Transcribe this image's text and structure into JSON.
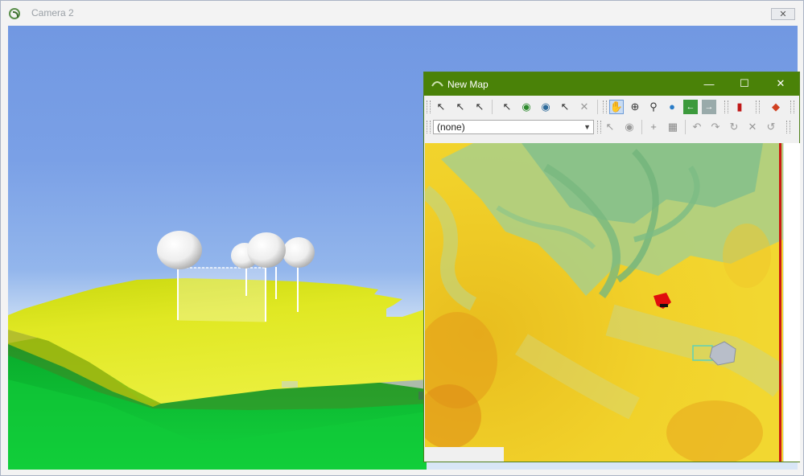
{
  "window": {
    "title": "Camera 2",
    "close_glyph": "✕"
  },
  "map_window": {
    "title": "New Map",
    "minimize": "—",
    "maximize": "☐",
    "close": "✕"
  },
  "toolbar1": {
    "icons": [
      "select-arrow-icon",
      "select-tool-icon",
      "select-attributes-icon",
      "pointer-icon",
      "green-arrow-icon",
      "globe-select-icon",
      "pointer-plus-icon",
      "delete-x-icon",
      "pan-hand-icon",
      "zoom-in-icon",
      "zoom-icon",
      "globe-icon",
      "back-arrow-icon",
      "forward-arrow-icon",
      "red-marker-icon",
      "layers-icon"
    ]
  },
  "toolbar2": {
    "layer_select_value": "(none)",
    "icons": [
      "add-point-icon",
      "edit-globe-icon",
      "plus-icon",
      "grid-icon",
      "undo-icon",
      "redo-icon",
      "rotate-icon",
      "delete-icon",
      "refresh-icon"
    ]
  },
  "colors": {
    "map_titlebar": "#4a8208",
    "map_border_line": "#cc1a12",
    "terrain_yellow": "#d8e21a",
    "terrain_green": "#11c633"
  }
}
